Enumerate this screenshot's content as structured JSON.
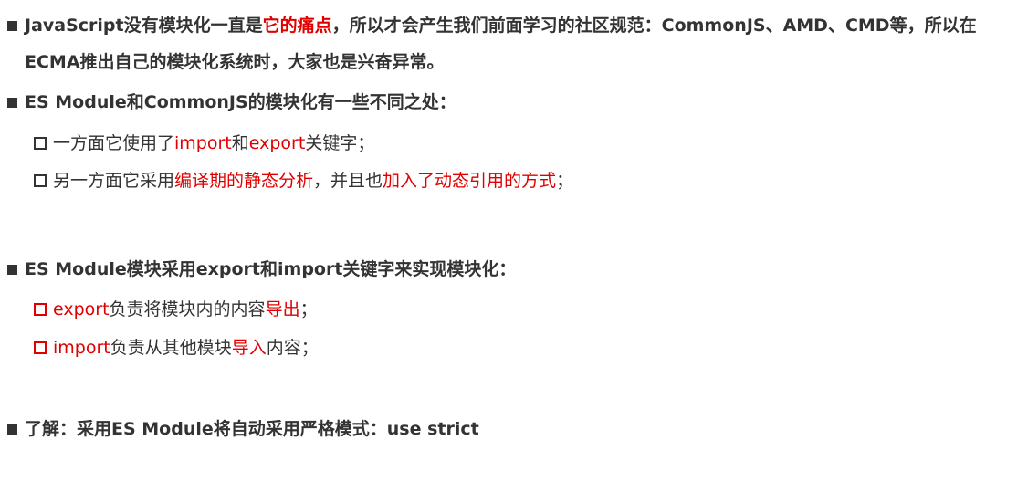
{
  "section1": {
    "line1_a": "JavaScript没有模块化一直是",
    "line1_highlight": "它的痛点",
    "line1_b": "，所以才会产生我们前面学习的社区规范：CommonJS、AMD、CMD等，所以在",
    "line2": "ECMA推出自己的模块化系统时，大家也是兴奋异常。"
  },
  "section2": {
    "heading": "ES Module和CommonJS的模块化有一些不同之处：",
    "item1": {
      "a": "一方面它使用了",
      "b": "import",
      "c": "和",
      "d": "export",
      "e": "关键字；"
    },
    "item2": {
      "a": "另一方面它采用",
      "b": "编译期的静态分析",
      "c": "，并且也",
      "d": "加入了动态引用的方式",
      "e": "；"
    }
  },
  "section3": {
    "heading": "ES Module模块采用export和import关键字来实现模块化：",
    "item1": {
      "a": "export",
      "b": "负责将模块内的内容",
      "c": "导出",
      "d": "；"
    },
    "item2": {
      "a": "import",
      "b": "负责从其他模块",
      "c": "导入",
      "d": "内容；"
    }
  },
  "section4": {
    "heading": "了解：采用ES Module将自动采用严格模式：use strict"
  },
  "colors": {
    "text": "#333333",
    "accent_red": "#e00000"
  }
}
